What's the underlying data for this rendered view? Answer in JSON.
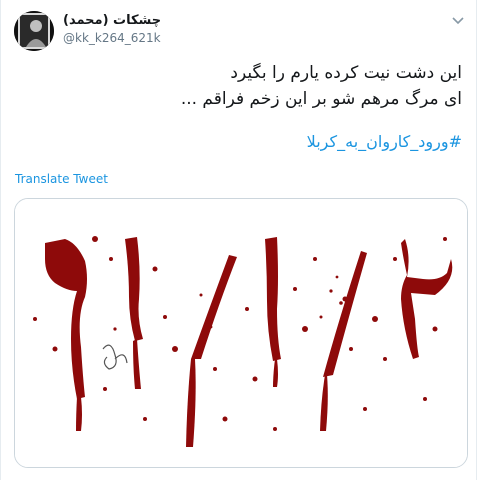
{
  "user": {
    "display_name": "چشکات (محمد)",
    "handle": "@kk_k264_621k"
  },
  "tweet": {
    "lines": [
      "این دشت نیت کرده یارم را بگیرد",
      "ای مرگ مرهم شو بر این زخم فراقم ..."
    ],
    "hashtag": "#ورود_کاروان_به_کربلا"
  },
  "actions": {
    "translate_label": "Translate Tweet"
  },
  "media": {
    "image_text": "۲/۱/۶۱",
    "signature": "محمدی"
  },
  "colors": {
    "link": "#1b95e0",
    "text": "#14171a",
    "muted": "#657786",
    "blood": "#8e0a0a"
  },
  "icons": {
    "menu": "chevron-down-icon"
  }
}
